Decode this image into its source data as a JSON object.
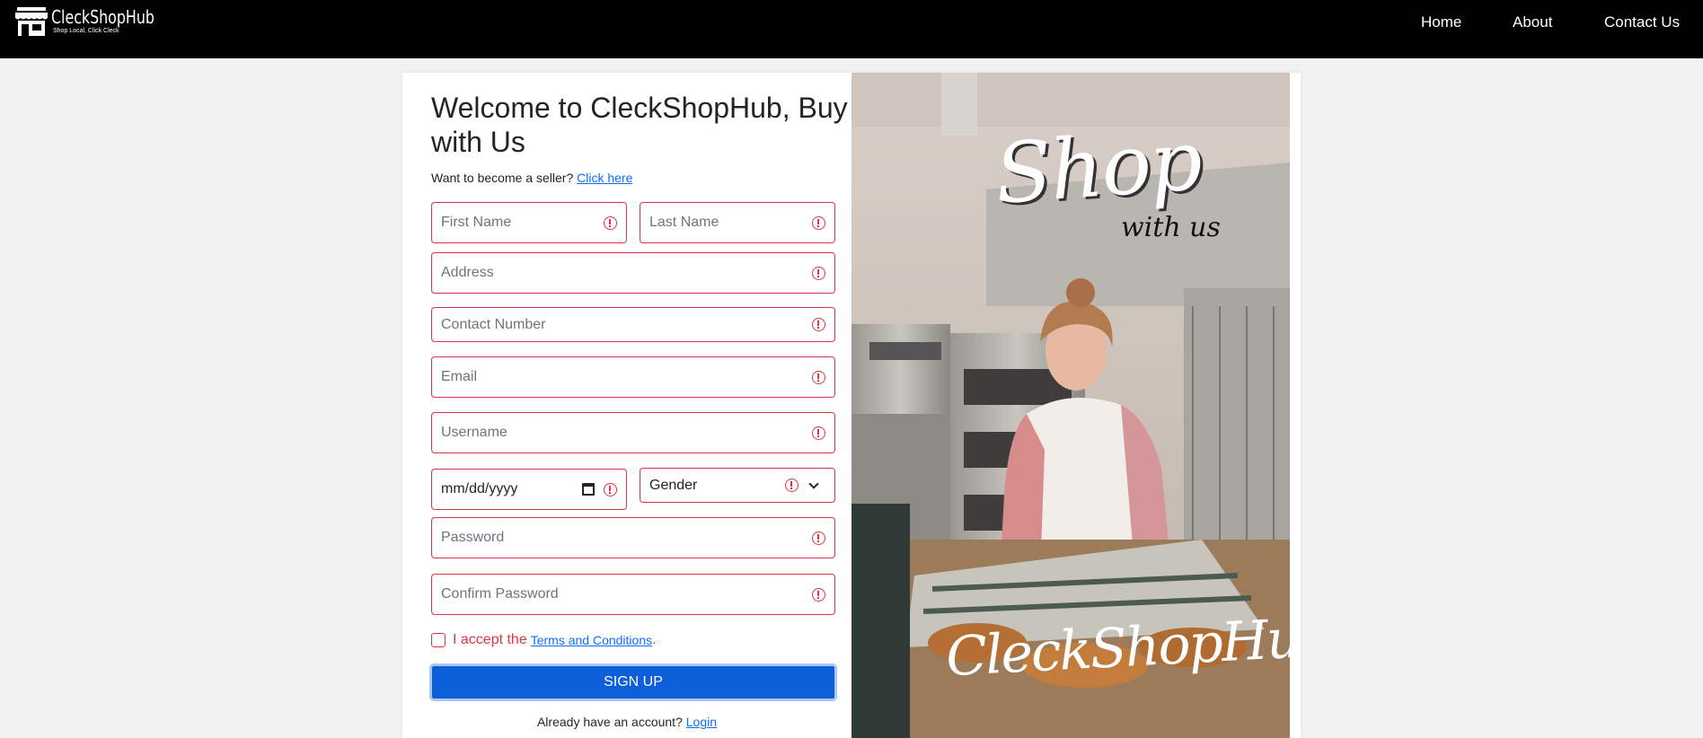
{
  "navbar": {
    "brand_name": "CleckShopHub",
    "brand_tagline": "Shop Local, Click Cleck",
    "links": [
      "Home",
      "About",
      "Contact Us"
    ]
  },
  "form": {
    "title": "Welcome to CleckShopHub, Buy with Us",
    "seller_prompt": "Want to become a seller?",
    "seller_link": "Click here",
    "fields": {
      "first_name": "First Name",
      "last_name": "Last Name",
      "address": "Address",
      "contact": "Contact Number",
      "email": "Email",
      "username": "Username",
      "dob": "mm/dd/yyyy",
      "gender": "Gender",
      "password": "Password",
      "confirm_password": "Confirm Password"
    },
    "terms_prefix": "I accept the",
    "terms_link": "Terms and Conditions",
    "terms_suffix": ".",
    "signup_label": "SIGN UP",
    "login_prompt": "Already have an account?",
    "login_link": "Login",
    "error_color": "#dc3545",
    "accent_color": "#0d5ed9"
  },
  "image": {
    "overlay_big": "Shop",
    "overlay_small": "with us",
    "overlay_brand": "CleckShopHub"
  }
}
